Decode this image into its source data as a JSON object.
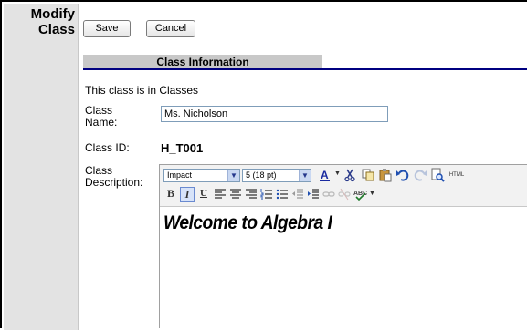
{
  "page": {
    "title": "Modify Class"
  },
  "toolbar": {
    "save_label": "Save",
    "cancel_label": "Cancel"
  },
  "section": {
    "header": "Class Information",
    "context_text": "This class is in Classes"
  },
  "form": {
    "class_name_label": "Class Name:",
    "class_name_value": "Ms. Nicholson",
    "class_id_label": "Class ID:",
    "class_id_value": "H_T001",
    "class_description_label": "Class Description:"
  },
  "editor": {
    "font_select": "Impact",
    "size_select": "5 (18 pt)",
    "html_button_label": "HTML",
    "content": "Welcome to Algebra I",
    "icons": [
      "font-color-icon",
      "cut-icon",
      "copy-icon",
      "paste-icon",
      "undo-icon",
      "redo-icon",
      "preview-icon",
      "html-icon",
      "bold-icon",
      "italic-icon",
      "underline-icon",
      "align-left-icon",
      "align-center-icon",
      "align-right-icon",
      "ordered-list-icon",
      "unordered-list-icon",
      "outdent-icon",
      "indent-icon",
      "link-icon",
      "unlink-icon",
      "spellcheck-icon"
    ],
    "bold_label": "B",
    "italic_label": "I",
    "underline_label": "U"
  },
  "colors": {
    "sidebar_bg": "#e3e3e3",
    "section_header_bg": "#c8c8c8",
    "section_rule": "#000080",
    "toolbar_bg": "#f2f2f2"
  }
}
